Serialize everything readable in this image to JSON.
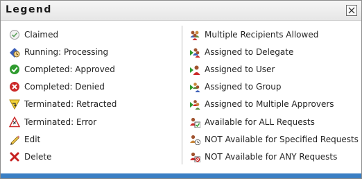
{
  "dialog": {
    "title": "Legend",
    "close_label": "X"
  },
  "left_items": [
    {
      "label": "Claimed",
      "icon": "claimed-check-icon"
    },
    {
      "label": "Running: Processing",
      "icon": "running-processing-icon"
    },
    {
      "label": "Completed: Approved",
      "icon": "approved-check-icon"
    },
    {
      "label": "Completed: Denied",
      "icon": "denied-x-icon"
    },
    {
      "label": "Terminated: Retracted",
      "icon": "retracted-icon"
    },
    {
      "label": "Terminated: Error",
      "icon": "error-warning-icon"
    },
    {
      "label": "Edit",
      "icon": "pencil-icon"
    },
    {
      "label": "Delete",
      "icon": "delete-x-icon"
    }
  ],
  "right_items": [
    {
      "label": "Multiple Recipients Allowed",
      "icon": "multiple-recipients-icon"
    },
    {
      "label": "Assigned to Delegate",
      "icon": "delegate-icon"
    },
    {
      "label": "Assigned to User",
      "icon": "user-icon"
    },
    {
      "label": "Assigned to Group",
      "icon": "group-icon"
    },
    {
      "label": "Assigned to Multiple Approvers",
      "icon": "multiple-approvers-icon"
    },
    {
      "label": "Available for ALL Requests",
      "icon": "available-all-icon"
    },
    {
      "label": "NOT Available for Specified Requests",
      "icon": "not-available-specified-icon"
    },
    {
      "label": "NOT Available for ANY Requests",
      "icon": "not-available-any-icon"
    }
  ],
  "colors": {
    "footer_bar": "#3a7fc4",
    "approved_green": "#2f9b2f",
    "denied_red": "#cc2a2a",
    "processing_blue": "#3b5fb8"
  }
}
